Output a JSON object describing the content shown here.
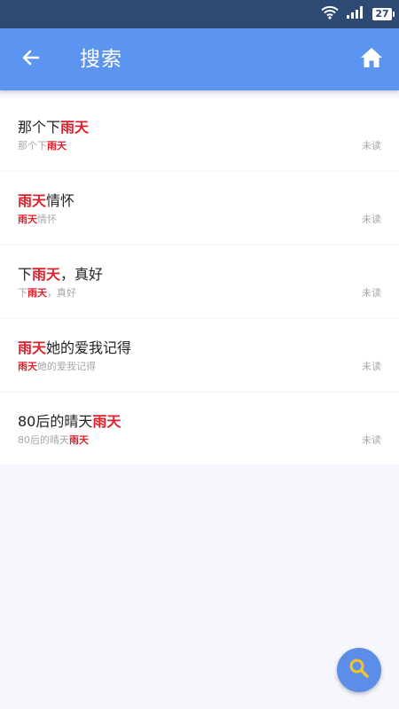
{
  "status_bar": {
    "battery_level": "27",
    "icons": [
      "wifi-icon",
      "signal-icon",
      "battery-icon"
    ]
  },
  "app_bar": {
    "title": "搜索",
    "back_icon": "arrow-left-icon",
    "home_icon": "home-icon"
  },
  "results": [
    {
      "title": [
        {
          "text": "那个下",
          "hl": false
        },
        {
          "text": "雨天",
          "hl": true
        }
      ],
      "subtitle": [
        {
          "text": "那个下",
          "hl": false
        },
        {
          "text": "雨天",
          "hl": true
        }
      ],
      "status": "未读"
    },
    {
      "title": [
        {
          "text": "雨天",
          "hl": true
        },
        {
          "text": "情怀",
          "hl": false
        }
      ],
      "subtitle": [
        {
          "text": "雨天",
          "hl": true
        },
        {
          "text": "情怀",
          "hl": false
        }
      ],
      "status": "未读"
    },
    {
      "title": [
        {
          "text": "下",
          "hl": false
        },
        {
          "text": "雨天",
          "hl": true
        },
        {
          "text": "，真好",
          "hl": false
        }
      ],
      "subtitle": [
        {
          "text": "下",
          "hl": false
        },
        {
          "text": "雨天",
          "hl": true
        },
        {
          "text": "，真好",
          "hl": false
        }
      ],
      "status": "未读"
    },
    {
      "title": [
        {
          "text": "雨天",
          "hl": true
        },
        {
          "text": "她的爱我记得",
          "hl": false
        }
      ],
      "subtitle": [
        {
          "text": "雨天",
          "hl": true
        },
        {
          "text": "她的爱我记得",
          "hl": false
        }
      ],
      "status": "未读"
    },
    {
      "title": [
        {
          "text": "80后的晴天",
          "hl": false
        },
        {
          "text": "雨天",
          "hl": true
        }
      ],
      "subtitle": [
        {
          "text": "80后的晴天",
          "hl": false
        },
        {
          "text": "雨天",
          "hl": true
        }
      ],
      "status": "未读"
    }
  ],
  "fab": {
    "icon": "search-icon"
  },
  "colors": {
    "status_bar": "#2d4a75",
    "app_bar": "#5b95f0",
    "highlight": "#e0202a",
    "fab": "#5b8de9",
    "fab_icon": "#f5c22b",
    "background": "#f5f7fd"
  }
}
